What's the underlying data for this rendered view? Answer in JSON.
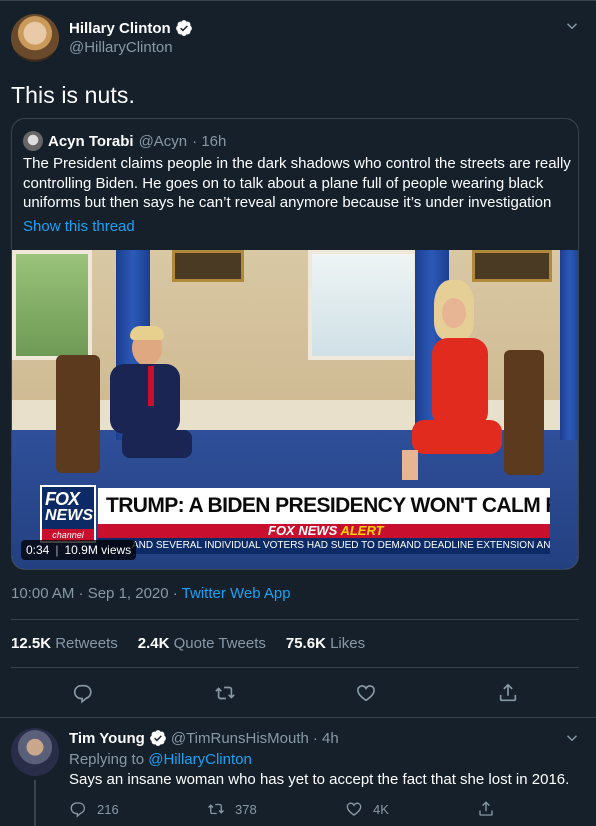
{
  "main_tweet": {
    "author_name": "Hillary Clinton",
    "author_handle": "@HillaryClinton",
    "text": "This is nuts.",
    "timestamp": "10:00 AM · Sep 1, 2020 · ",
    "source": "Twitter Web App",
    "stats": {
      "retweets_count": "12.5K",
      "retweets_label": "Retweets",
      "quote_count": "2.4K",
      "quote_label": "Quote Tweets",
      "likes_count": "75.6K",
      "likes_label": "Likes"
    }
  },
  "quoted_tweet": {
    "author_name": "Acyn Torabi",
    "author_handle": "@Acyn",
    "time": "· 16h",
    "text": "The President claims people in the dark shadows who control the streets are really controlling Biden. He goes on to talk about a plane full of people wearing black uniforms but then says he can’t reveal anymore because it’s under investigation",
    "show_thread": "Show this thread",
    "video": {
      "logo_fox": "FOX",
      "logo_news": "NEWS",
      "logo_channel": "channel",
      "headline": "TRUMP: A BIDEN PRESIDENCY WON'T CALM RIOTS",
      "alert_prefix": "FOX NEWS ",
      "alert_word": "ALERT",
      "ticker": "AND SEVERAL INDIVIDUAL VOTERS HAD SUED TO DEMAND DEADLINE EXTENSION AN",
      "duration": "0:34",
      "views": "10.9M views"
    }
  },
  "reply": {
    "author_name": "Tim Young",
    "author_handle": "@TimRunsHisMouth",
    "time": "· 4h",
    "replying_prefix": "Replying to ",
    "replying_to": "@HillaryClinton",
    "text": "Says an insane woman who has yet to accept the fact that she lost in 2016.",
    "reply_count": "216",
    "retweet_count": "378",
    "like_count": "4K"
  },
  "colors": {
    "background": "#15202b",
    "border": "#38444d",
    "muted": "#8899a6",
    "accent": "#1da1f2"
  },
  "icons": [
    "verified-badge-icon",
    "chevron-down-icon",
    "reply-icon",
    "retweet-icon",
    "like-icon",
    "share-icon"
  ]
}
